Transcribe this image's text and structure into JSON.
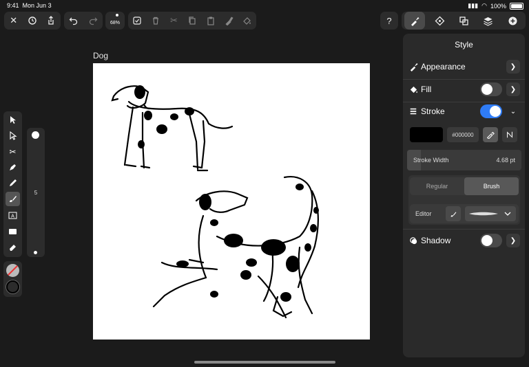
{
  "status": {
    "time": "9:41",
    "date": "Mon Jun 3",
    "battery": "100%"
  },
  "toolbar": {
    "left_icons": [
      "close-icon",
      "settings-icon",
      "share-icon"
    ],
    "history_icons": [
      "undo-icon",
      "redo-icon"
    ],
    "zoom": "68%",
    "edit_icons": [
      "select-all-icon",
      "trash-icon",
      "scissors-icon",
      "copy-icon",
      "paste-icon",
      "paste-style-icon",
      "paste-in-place-icon"
    ],
    "right_tabs": [
      "help-icon",
      "style-tab-icon",
      "symbols-icon",
      "path-ops-icon",
      "layers-icon",
      "add-icon"
    ],
    "help_label": "?"
  },
  "canvas": {
    "artboard_name": "Dog"
  },
  "left_tools": [
    "selection-tool-icon",
    "direct-selection-icon",
    "scissors-tool-icon",
    "pen-tool-icon",
    "pencil-tool-icon",
    "brush-tool-icon",
    "text-tool-icon",
    "rectangle-tool-icon",
    "eraser-tool-icon"
  ],
  "brush_size": {
    "value": "5"
  },
  "panel": {
    "title": "Style",
    "appearance": "Appearance",
    "fill": "Fill",
    "fill_on": false,
    "stroke": "Stroke",
    "stroke_on": true,
    "stroke_color": "#000000",
    "stroke_hex": "#000000",
    "stroke_width_label": "Stroke Width",
    "stroke_width_value": "4.68 pt",
    "mode_regular": "Regular",
    "mode_brush": "Brush",
    "editor_label": "Editor",
    "shadow": "Shadow",
    "shadow_on": false
  },
  "colors": {
    "accent": "#2f7cf6",
    "panel_bg": "#2a2a2a",
    "app_bg": "#1b1b1b"
  }
}
